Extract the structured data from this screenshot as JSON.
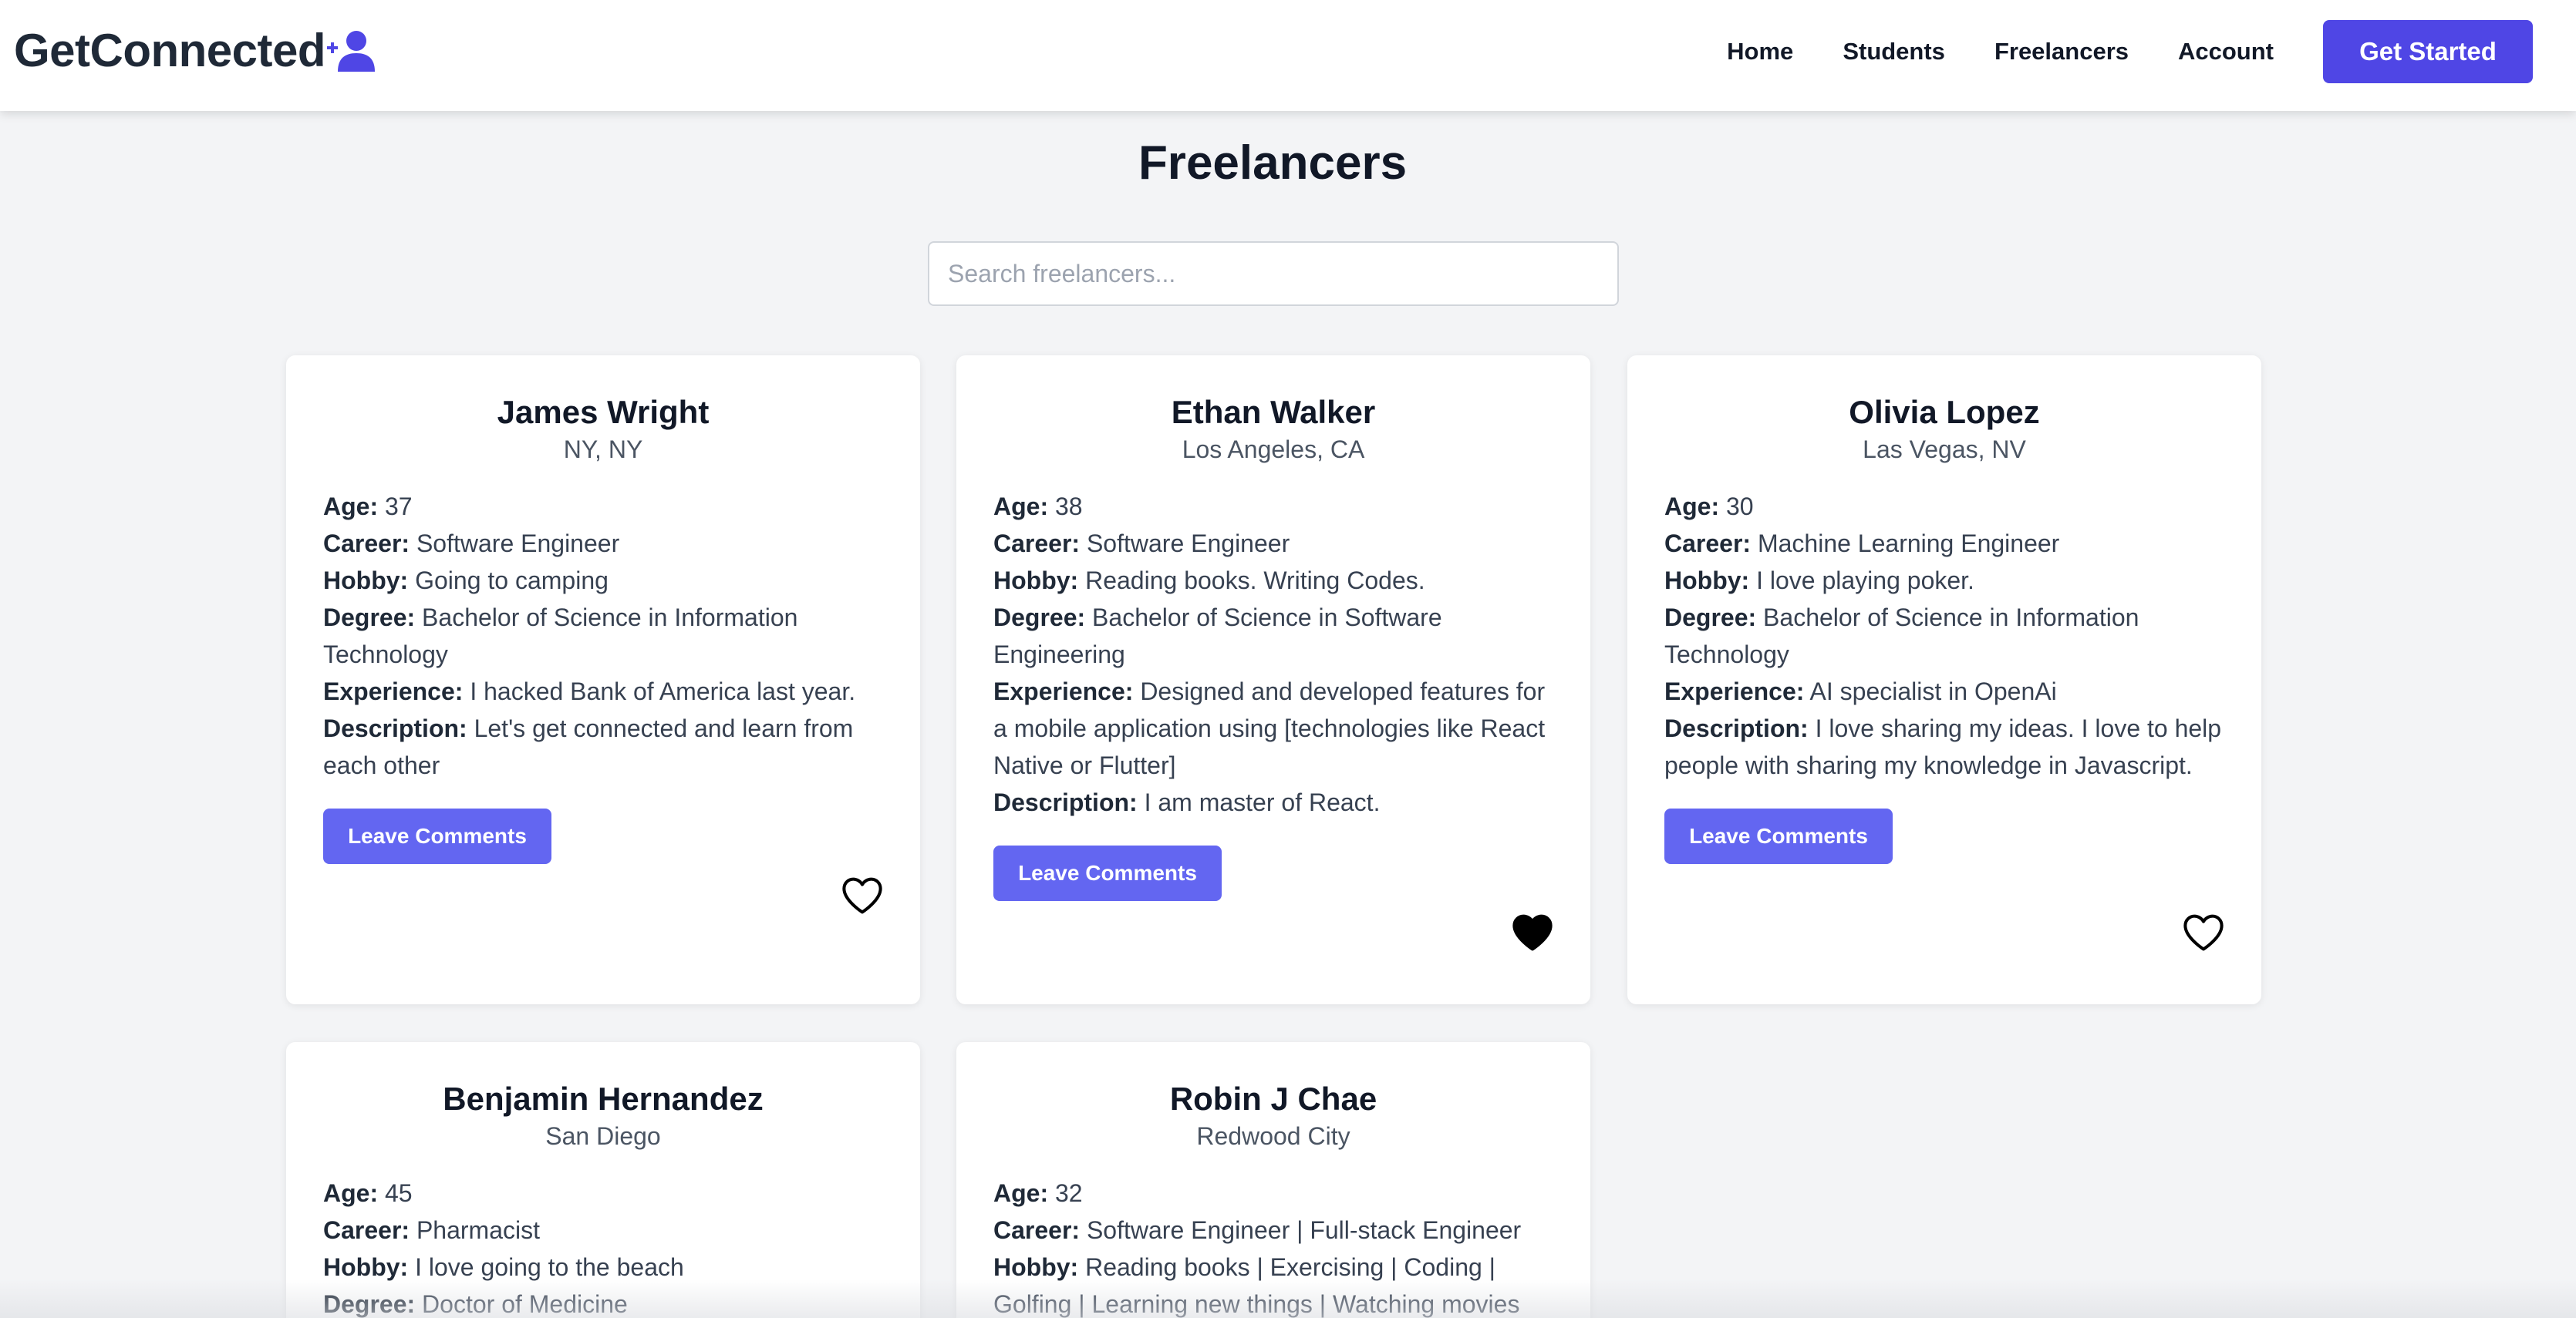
{
  "header": {
    "logo_text": "GetConnected",
    "nav": [
      "Home",
      "Students",
      "Freelancers",
      "Account"
    ],
    "cta_label": "Get Started"
  },
  "page": {
    "title": "Freelancers",
    "search_placeholder": "Search freelancers..."
  },
  "labels": {
    "age": "Age:",
    "career": "Career:",
    "hobby": "Hobby:",
    "degree": "Degree:",
    "experience": "Experience:",
    "description": "Description:",
    "comment_button": "Leave Comments"
  },
  "freelancers": [
    {
      "name": "James Wright",
      "location": "NY, NY",
      "age": "37",
      "career": "Software Engineer",
      "hobby": "Going to camping",
      "degree": "Bachelor of Science in Information Technology",
      "experience": "I hacked Bank of America last year.",
      "description": "Let's get connected and learn from each other",
      "favorited": false
    },
    {
      "name": "Ethan Walker",
      "location": "Los Angeles, CA",
      "age": "38",
      "career": "Software Engineer",
      "hobby": "Reading books. Writing Codes.",
      "degree": "Bachelor of Science in Software Engineering",
      "experience": "Designed and developed features for a mobile application using [technologies like React Native or Flutter]",
      "description": "I am master of React.",
      "favorited": true
    },
    {
      "name": "Olivia Lopez",
      "location": "Las Vegas, NV",
      "age": "30",
      "career": "Machine Learning Engineer",
      "hobby": "I love playing poker.",
      "degree": "Bachelor of Science in Information Technology",
      "experience": "AI specialist in OpenAi",
      "description": "I love sharing my ideas. I love to help people with sharing my knowledge in Javascript.",
      "favorited": false
    },
    {
      "name": "Benjamin Hernandez",
      "location": "San Diego",
      "age": "45",
      "career": "Pharmacist",
      "hobby": "I love going to the beach",
      "degree": "Doctor of Medicine"
    },
    {
      "name": "Robin J Chae",
      "location": "Redwood City",
      "age": "32",
      "career": "Software Engineer | Full-stack Engineer",
      "hobby": "Reading books | Exercising | Coding | Golfing | Learning new things | Watching movies"
    }
  ],
  "colors": {
    "brand": "#4f46e5",
    "button": "#6366f1",
    "background": "#f3f4f6"
  }
}
